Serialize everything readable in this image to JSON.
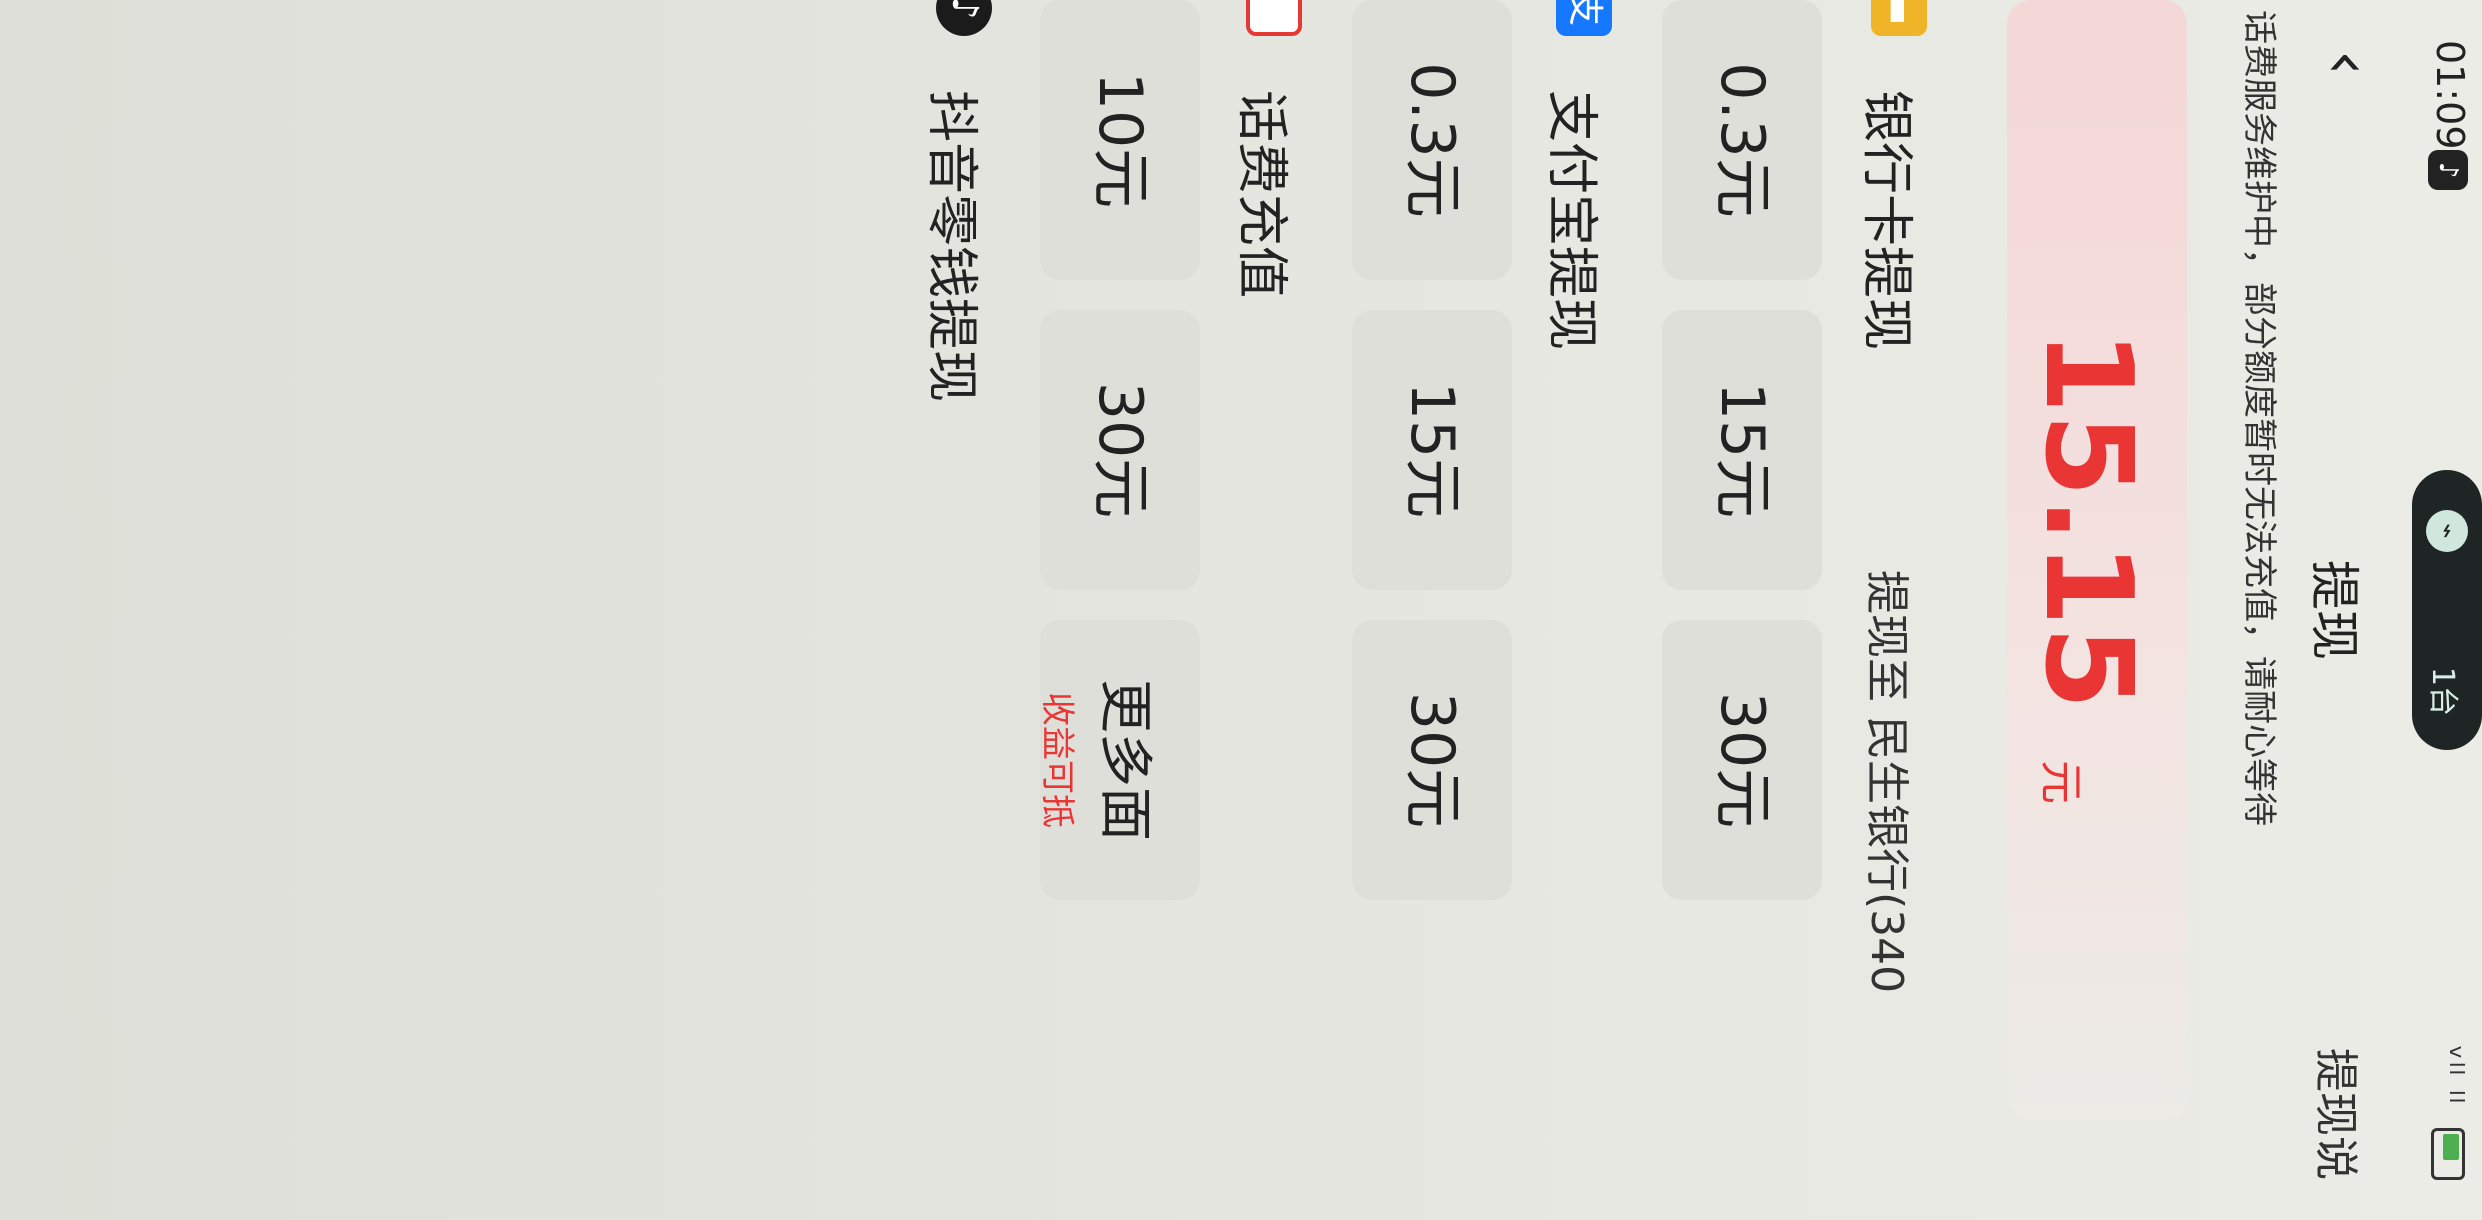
{
  "status_bar": {
    "time": "01:09",
    "app_icon": "tiktok-icon",
    "pill_text": "1台",
    "signal": "ᵛˡˡ ˡˡ"
  },
  "nav": {
    "title": "提现",
    "right_text": "提现说"
  },
  "notice": "话费服务维护中，部分额度暂时无法充值，请耐心等待",
  "balance": {
    "amount": "15.15",
    "unit": "元"
  },
  "sections": {
    "bank": {
      "label": "银行卡提现",
      "right": "提现至 民生银行(340",
      "options": [
        "0.3元",
        "15元",
        "30元"
      ]
    },
    "alipay": {
      "label": "支付宝提现",
      "icon_text": "支",
      "options": [
        "0.3元",
        "15元",
        "30元"
      ]
    },
    "phone": {
      "label": "话费充值",
      "options": [
        "10元",
        "30元"
      ],
      "more_title": "更多面",
      "more_sub": "收益可抵"
    },
    "douyin": {
      "label": "抖音零钱提现"
    }
  },
  "colors": {
    "accent_red": "#ea3535",
    "bank_icon": "#f0b428",
    "alipay_icon": "#1677ff",
    "phone_icon": "#e53935",
    "douyin_icon": "#1b1b1b"
  }
}
